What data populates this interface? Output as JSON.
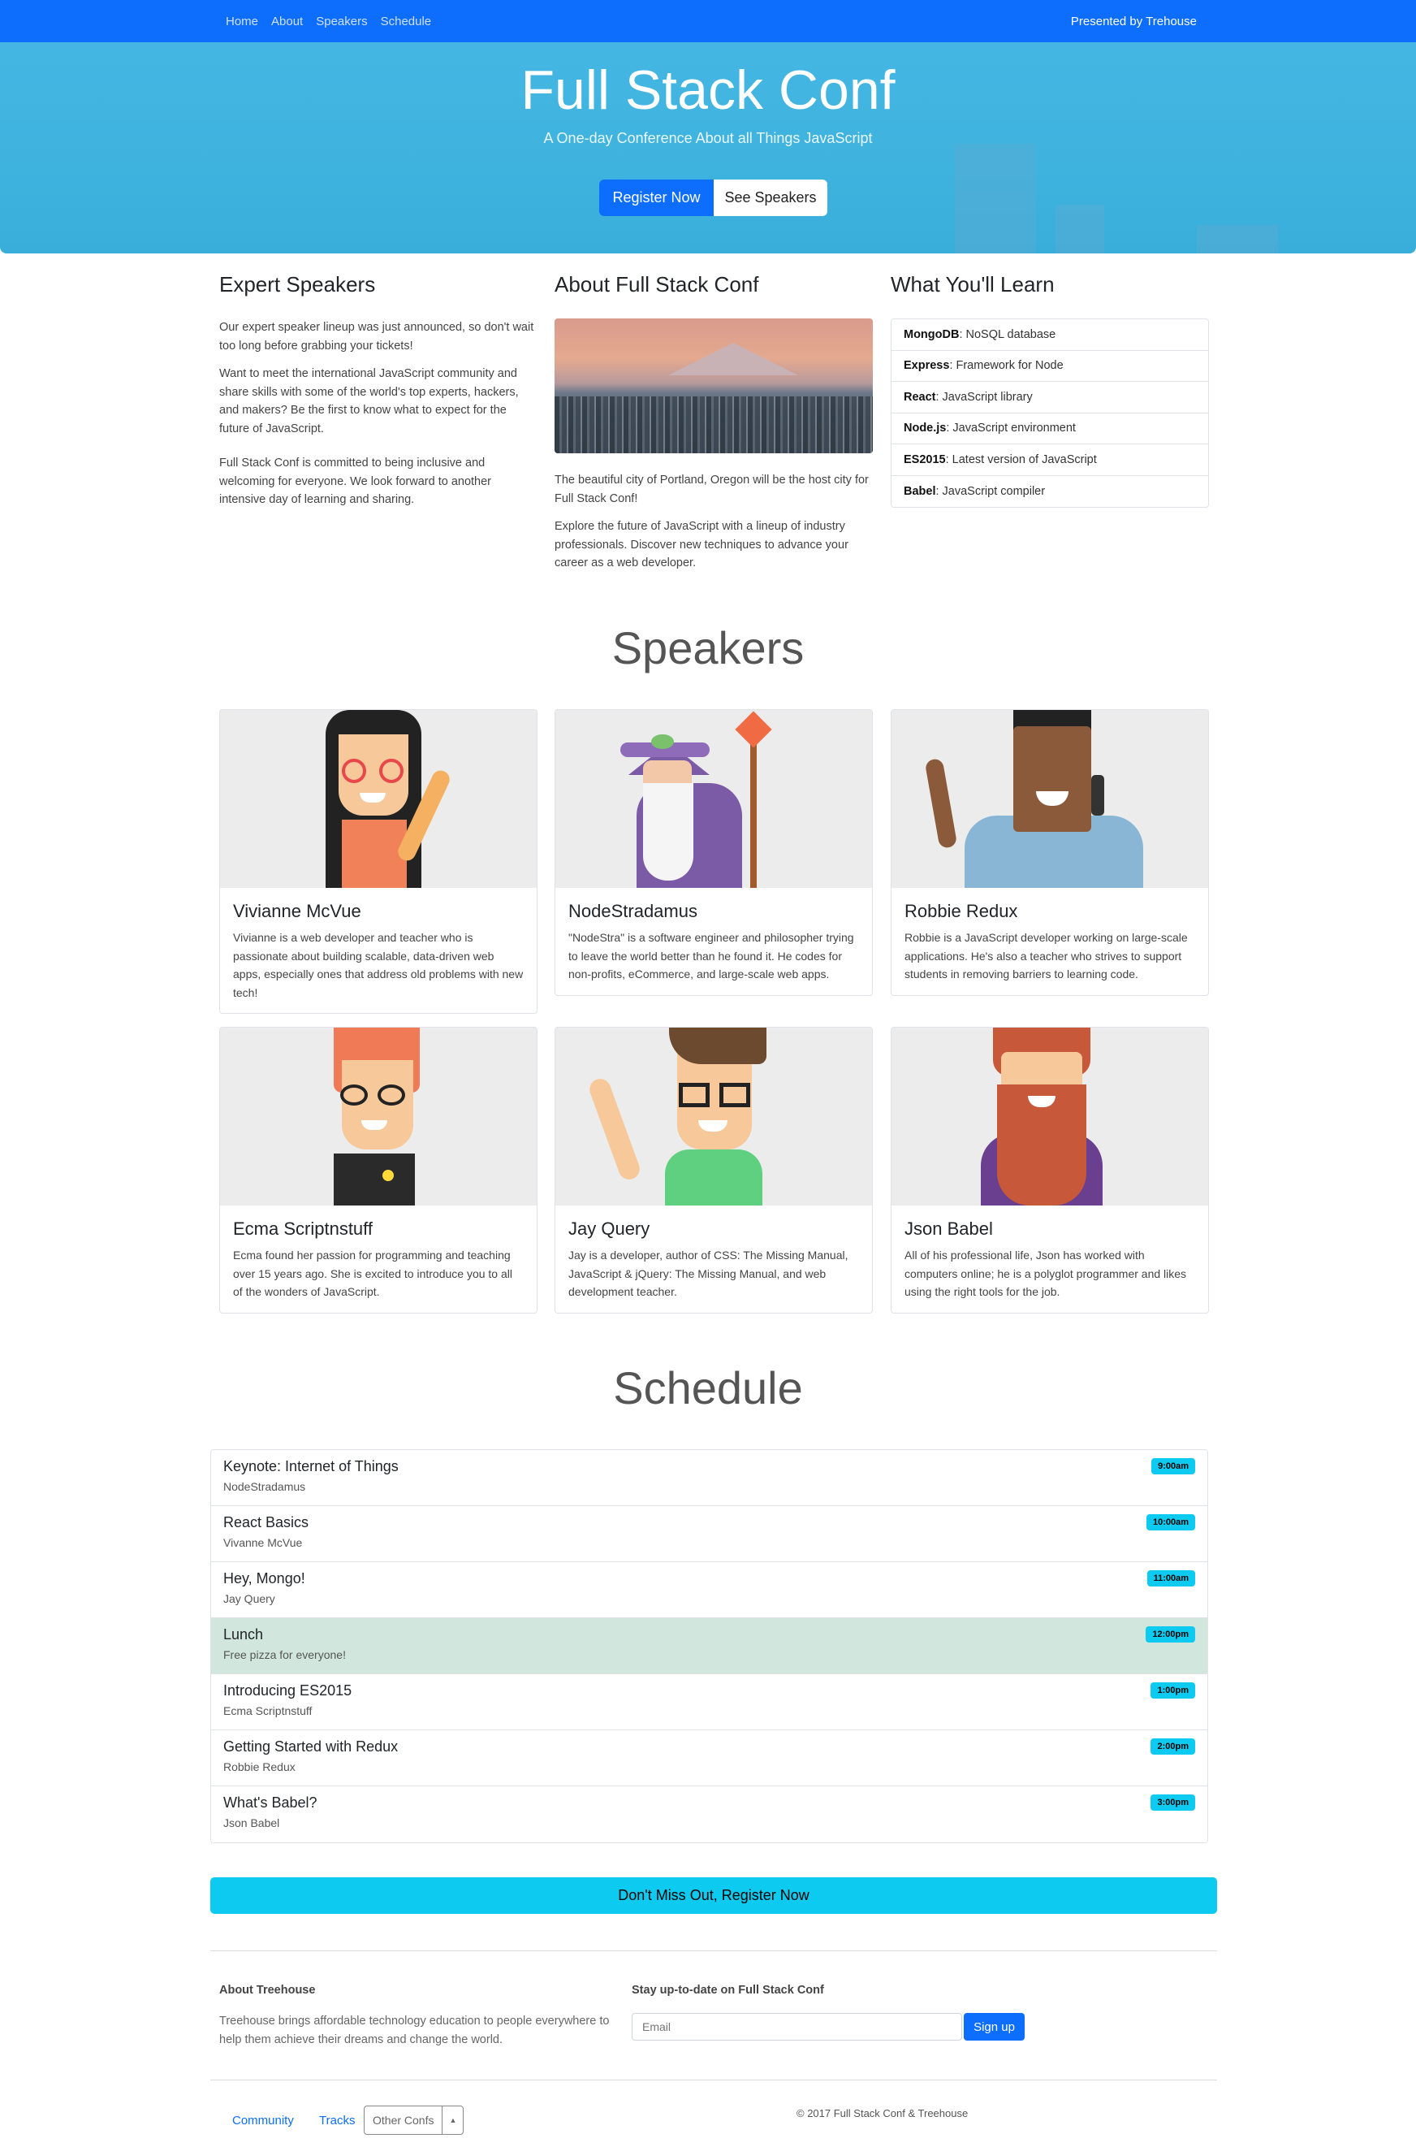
{
  "nav": {
    "links": [
      "Home",
      "About",
      "Speakers",
      "Schedule"
    ],
    "right_text": "Presented by Trehouse"
  },
  "hero": {
    "title": "Full Stack Conf",
    "subtitle": "A One-day Conference About all Things JavaScript",
    "register_label": "Register Now",
    "speakers_label": "See Speakers",
    "colors": {
      "background": "#3eb3de",
      "primary": "#0d6efd"
    }
  },
  "intro": {
    "expert": {
      "heading": "Expert Speakers",
      "paragraphs": [
        "Our expert speaker lineup was just announced, so don't wait too long before grabbing your tickets!",
        "Want to meet the international JavaScript community and share skills with some of the world's top experts, hackers, and makers? Be the first to know what to expect for the future of JavaScript.",
        "Full Stack Conf is committed to being inclusive and welcoming for everyone. We look forward to another intensive day of learning and sharing."
      ]
    },
    "about": {
      "heading": "About Full Stack Conf",
      "paragraphs": [
        "The beautiful city of Portland, Oregon will be the host city for Full Stack Conf!",
        "Explore the future of JavaScript with a lineup of industry professionals. Discover new techniques to advance your career as a web developer."
      ]
    },
    "learn": {
      "heading": "What You'll Learn",
      "items": [
        {
          "term": "MongoDB",
          "desc": ": NoSQL database"
        },
        {
          "term": "Express",
          "desc": ": Framework for Node"
        },
        {
          "term": "React",
          "desc": ": JavaScript library"
        },
        {
          "term": "Node.js",
          "desc": ": JavaScript environment"
        },
        {
          "term": "ES2015",
          "desc": ": Latest version of JavaScript"
        },
        {
          "term": "Babel",
          "desc": ": JavaScript compiler"
        }
      ]
    }
  },
  "speakers": {
    "heading": "Speakers",
    "cards": [
      {
        "name": "Vivianne McVue",
        "bio": "Vivianne is a web developer and teacher who is passionate about building scalable, data-driven web apps, especially ones that address old problems with new tech!"
      },
      {
        "name": "NodeStradamus",
        "bio": "\"NodeStra\" is a software engineer and philosopher trying to leave the world better than he found it. He codes for non-profits, eCommerce, and large-scale web apps."
      },
      {
        "name": "Robbie Redux",
        "bio": "Robbie is a JavaScript developer working on large-scale applications. He's also a teacher who strives to support students in removing barriers to learning code."
      },
      {
        "name": "Ecma Scriptnstuff",
        "bio": "Ecma found her passion for programming and teaching over 15 years ago. She is excited to introduce you to all of the wonders of JavaScript."
      },
      {
        "name": "Jay Query",
        "bio": "Jay is a developer, author of CSS: The Missing Manual, JavaScript & jQuery: The Missing Manual, and web development teacher."
      },
      {
        "name": "Json Babel",
        "bio": "All of his professional life, Json has worked with computers online; he is a polyglot programmer and likes using the right tools for the job."
      }
    ]
  },
  "schedule": {
    "heading": "Schedule",
    "rows": [
      {
        "title": "Keynote: Internet of Things",
        "speaker": "NodeStradamus",
        "time": "9:00am"
      },
      {
        "title": "React Basics",
        "speaker": "Vivanne McVue",
        "time": "10:00am"
      },
      {
        "title": "Hey, Mongo!",
        "speaker": "Jay Query",
        "time": "11:00am"
      },
      {
        "title": "Lunch",
        "speaker": "Free pizza for everyone!",
        "time": "12:00pm"
      },
      {
        "title": "Introducing ES2015",
        "speaker": "Ecma Scriptnstuff",
        "time": "1:00pm"
      },
      {
        "title": "Getting Started with Redux",
        "speaker": "Robbie Redux",
        "time": "2:00pm"
      },
      {
        "title": "What's Babel?",
        "speaker": "Json Babel",
        "time": "3:00pm"
      }
    ],
    "cta_label": "Don't Miss Out, Register Now"
  },
  "footer": {
    "about_heading": "About Treehouse",
    "about_text": "Treehouse brings affordable technology education to people everywhere to help them achieve their dreams and change the world.",
    "newsletter_heading": "Stay up-to-date on Full Stack Conf",
    "email_placeholder": "Email",
    "signup_label": "Sign up",
    "links": [
      "Community",
      "Tracks"
    ],
    "select_label": "Other Confs",
    "copyright": "© 2017 Full Stack Conf & Treehouse"
  }
}
